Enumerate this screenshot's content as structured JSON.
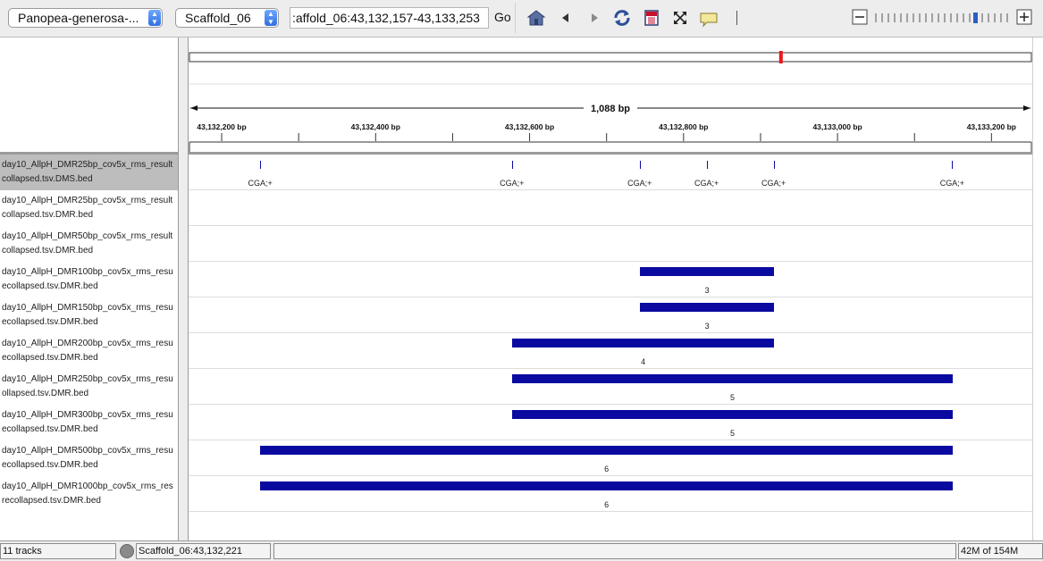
{
  "toolbar": {
    "genome": "Panopea-generosa-...",
    "chromosome": "Scaffold_06",
    "locus": ":affold_06:43,132,157-43,133,253",
    "go_label": "Go",
    "icons": [
      "home-icon",
      "back-icon",
      "forward-icon",
      "refresh-icon",
      "roi-icon",
      "fit-window-icon",
      "popup-text-icon"
    ],
    "zoom_minus": "−",
    "zoom_plus": "+"
  },
  "ruler": {
    "span_label": "1,088 bp",
    "tick_labels": [
      "43,132,200 bp",
      "43,132,400 bp",
      "43,132,600 bp",
      "43,132,800 bp",
      "43,133,000 bp",
      "43,133,200 bp"
    ],
    "view_start": 43132157,
    "view_end": 43133253,
    "ideogram_marker_fraction": 0.7,
    "marker_color": "#e8191b"
  },
  "tracks": [
    {
      "name_line1": "day10_AllpH_DMR25bp_cov5x_rms_result",
      "name_line2": "collapsed.tsv.DMS.bed",
      "selected": true,
      "type": "sites",
      "sites": [
        {
          "pos": 43132250,
          "label": "CGA;+"
        },
        {
          "pos": 43132577,
          "label": "CGA;+"
        },
        {
          "pos": 43132743,
          "label": "CGA;+"
        },
        {
          "pos": 43132830,
          "label": "CGA;+"
        },
        {
          "pos": 43132917,
          "label": "CGA;+"
        },
        {
          "pos": 43133149,
          "label": "CGA;+"
        }
      ]
    },
    {
      "name_line1": "day10_AllpH_DMR25bp_cov5x_rms_result",
      "name_line2": "collapsed.tsv.DMR.bed",
      "selected": false,
      "type": "bars",
      "bars": []
    },
    {
      "name_line1": "day10_AllpH_DMR50bp_cov5x_rms_result",
      "name_line2": "collapsed.tsv.DMR.bed",
      "selected": false,
      "type": "bars",
      "bars": []
    },
    {
      "name_line1": "day10_AllpH_DMR100bp_cov5x_rms_resu",
      "name_line2": "ecollapsed.tsv.DMR.bed",
      "selected": false,
      "type": "bars",
      "bars": [
        {
          "start": 43132743,
          "end": 43132918,
          "label": "3"
        }
      ]
    },
    {
      "name_line1": "day10_AllpH_DMR150bp_cov5x_rms_resu",
      "name_line2": "ecollapsed.tsv.DMR.bed",
      "selected": false,
      "type": "bars",
      "bars": [
        {
          "start": 43132743,
          "end": 43132918,
          "label": "3"
        }
      ]
    },
    {
      "name_line1": "day10_AllpH_DMR200bp_cov5x_rms_resu",
      "name_line2": "ecollapsed.tsv.DMR.bed",
      "selected": false,
      "type": "bars",
      "bars": [
        {
          "start": 43132577,
          "end": 43132918,
          "label": "4"
        }
      ]
    },
    {
      "name_line1": "day10_AllpH_DMR250bp_cov5x_rms_resu",
      "name_line2": "ollapsed.tsv.DMR.bed",
      "selected": false,
      "type": "bars",
      "bars": [
        {
          "start": 43132577,
          "end": 43133150,
          "label": "5"
        }
      ]
    },
    {
      "name_line1": "day10_AllpH_DMR300bp_cov5x_rms_resu",
      "name_line2": "ecollapsed.tsv.DMR.bed",
      "selected": false,
      "type": "bars",
      "bars": [
        {
          "start": 43132577,
          "end": 43133150,
          "label": "5"
        }
      ]
    },
    {
      "name_line1": "day10_AllpH_DMR500bp_cov5x_rms_resu",
      "name_line2": "ecollapsed.tsv.DMR.bed",
      "selected": false,
      "type": "bars",
      "bars": [
        {
          "start": 43132250,
          "end": 43133150,
          "label": "6"
        }
      ]
    },
    {
      "name_line1": "day10_AllpH_DMR1000bp_cov5x_rms_res",
      "name_line2": "recollapsed.tsv.DMR.bed",
      "selected": false,
      "type": "bars",
      "bars": [
        {
          "start": 43132250,
          "end": 43133150,
          "label": "6"
        }
      ]
    }
  ],
  "feature_color": "#0a0aa0",
  "status": {
    "track_count": "11 tracks",
    "position": "Scaffold_06:43,132,221",
    "memory": "42M of 154M"
  }
}
